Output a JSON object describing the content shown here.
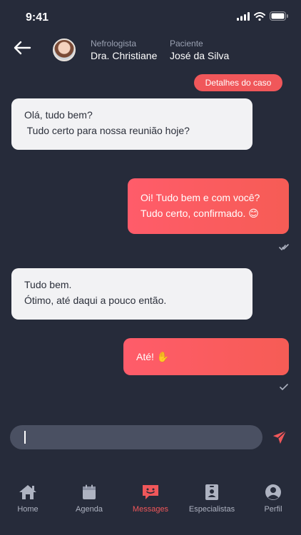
{
  "status": {
    "time": "9:41",
    "icons": [
      "signal-icon",
      "wifi-icon",
      "battery-icon"
    ]
  },
  "header": {
    "back_icon": "arrow-left-icon",
    "doctor_role": "Nefrologista",
    "doctor_name": "Dra. Christiane",
    "patient_role": "Paciente",
    "patient_name": "José da Silva"
  },
  "case_button": "Detalhes do caso",
  "messages": [
    {
      "direction": "in",
      "lines": [
        "Olá, tudo bem?",
        " Tudo certo para nossa reunião hoje?"
      ]
    },
    {
      "direction": "out",
      "lines": [
        "Oi! Tudo bem e com você?",
        "Tudo certo, confirmado. 😊"
      ],
      "status": "read"
    },
    {
      "direction": "in",
      "lines": [
        "Tudo bem.",
        "Ótimo, até daqui a pouco então."
      ]
    },
    {
      "direction": "out",
      "lines": [
        "Até! ✋"
      ],
      "status": "sent"
    }
  ],
  "composer": {
    "value": "",
    "placeholder": ""
  },
  "tabs": [
    {
      "label": "Home",
      "icon": "home-icon",
      "active": false
    },
    {
      "label": "Agenda",
      "icon": "calendar-icon",
      "active": false
    },
    {
      "label": "Messages",
      "icon": "chat-icon",
      "active": true
    },
    {
      "label": "Especialistas",
      "icon": "id-badge-icon",
      "active": false
    },
    {
      "label": "Perfil",
      "icon": "user-icon",
      "active": false
    }
  ],
  "colors": {
    "background": "#262b3a",
    "accent": "#f0575a",
    "incoming_bubble": "#f2f2f4",
    "composer": "#4a5062",
    "inactive_tab": "#aeb3c1"
  }
}
